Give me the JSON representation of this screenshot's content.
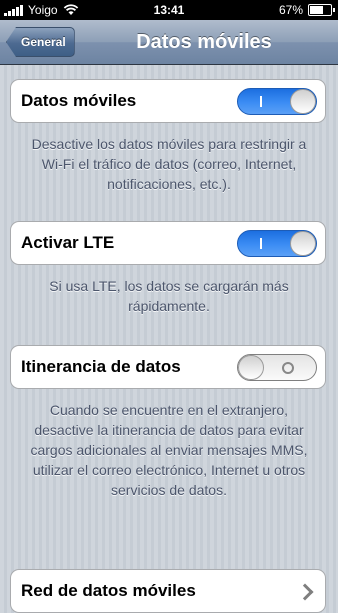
{
  "status_bar": {
    "carrier": "Yoigo",
    "time": "13:41",
    "battery_percent": "67%",
    "battery_level": 0.67,
    "icons": [
      "signal-bars-icon",
      "wifi-icon",
      "battery-icon"
    ]
  },
  "nav": {
    "back_label": "General",
    "title": "Datos móviles"
  },
  "settings": [
    {
      "label": "Datos móviles",
      "toggle": true,
      "footer": "Desactive los datos móviles para restringir a Wi-Fi el tráfico de datos (correo, Internet, notificaciones, etc.)."
    },
    {
      "label": "Activar LTE",
      "toggle": true,
      "footer": "Si usa LTE, los datos se cargarán más rápidamente."
    },
    {
      "label": "Itinerancia de datos",
      "toggle": false,
      "footer": "Cuando se encuentre en el extranjero, desactive la itinerancia de datos para evitar cargos adicionales al enviar mensajes MMS, utilizar el correo electrónico, Internet u otros servicios de datos."
    },
    {
      "label": "Red de datos móviles"
    }
  ],
  "colors": {
    "toggle_on": "#3c8df4",
    "nav_bar": "#6d84a2",
    "background": "#c5ccd4",
    "footer_text": "#4c566c"
  }
}
